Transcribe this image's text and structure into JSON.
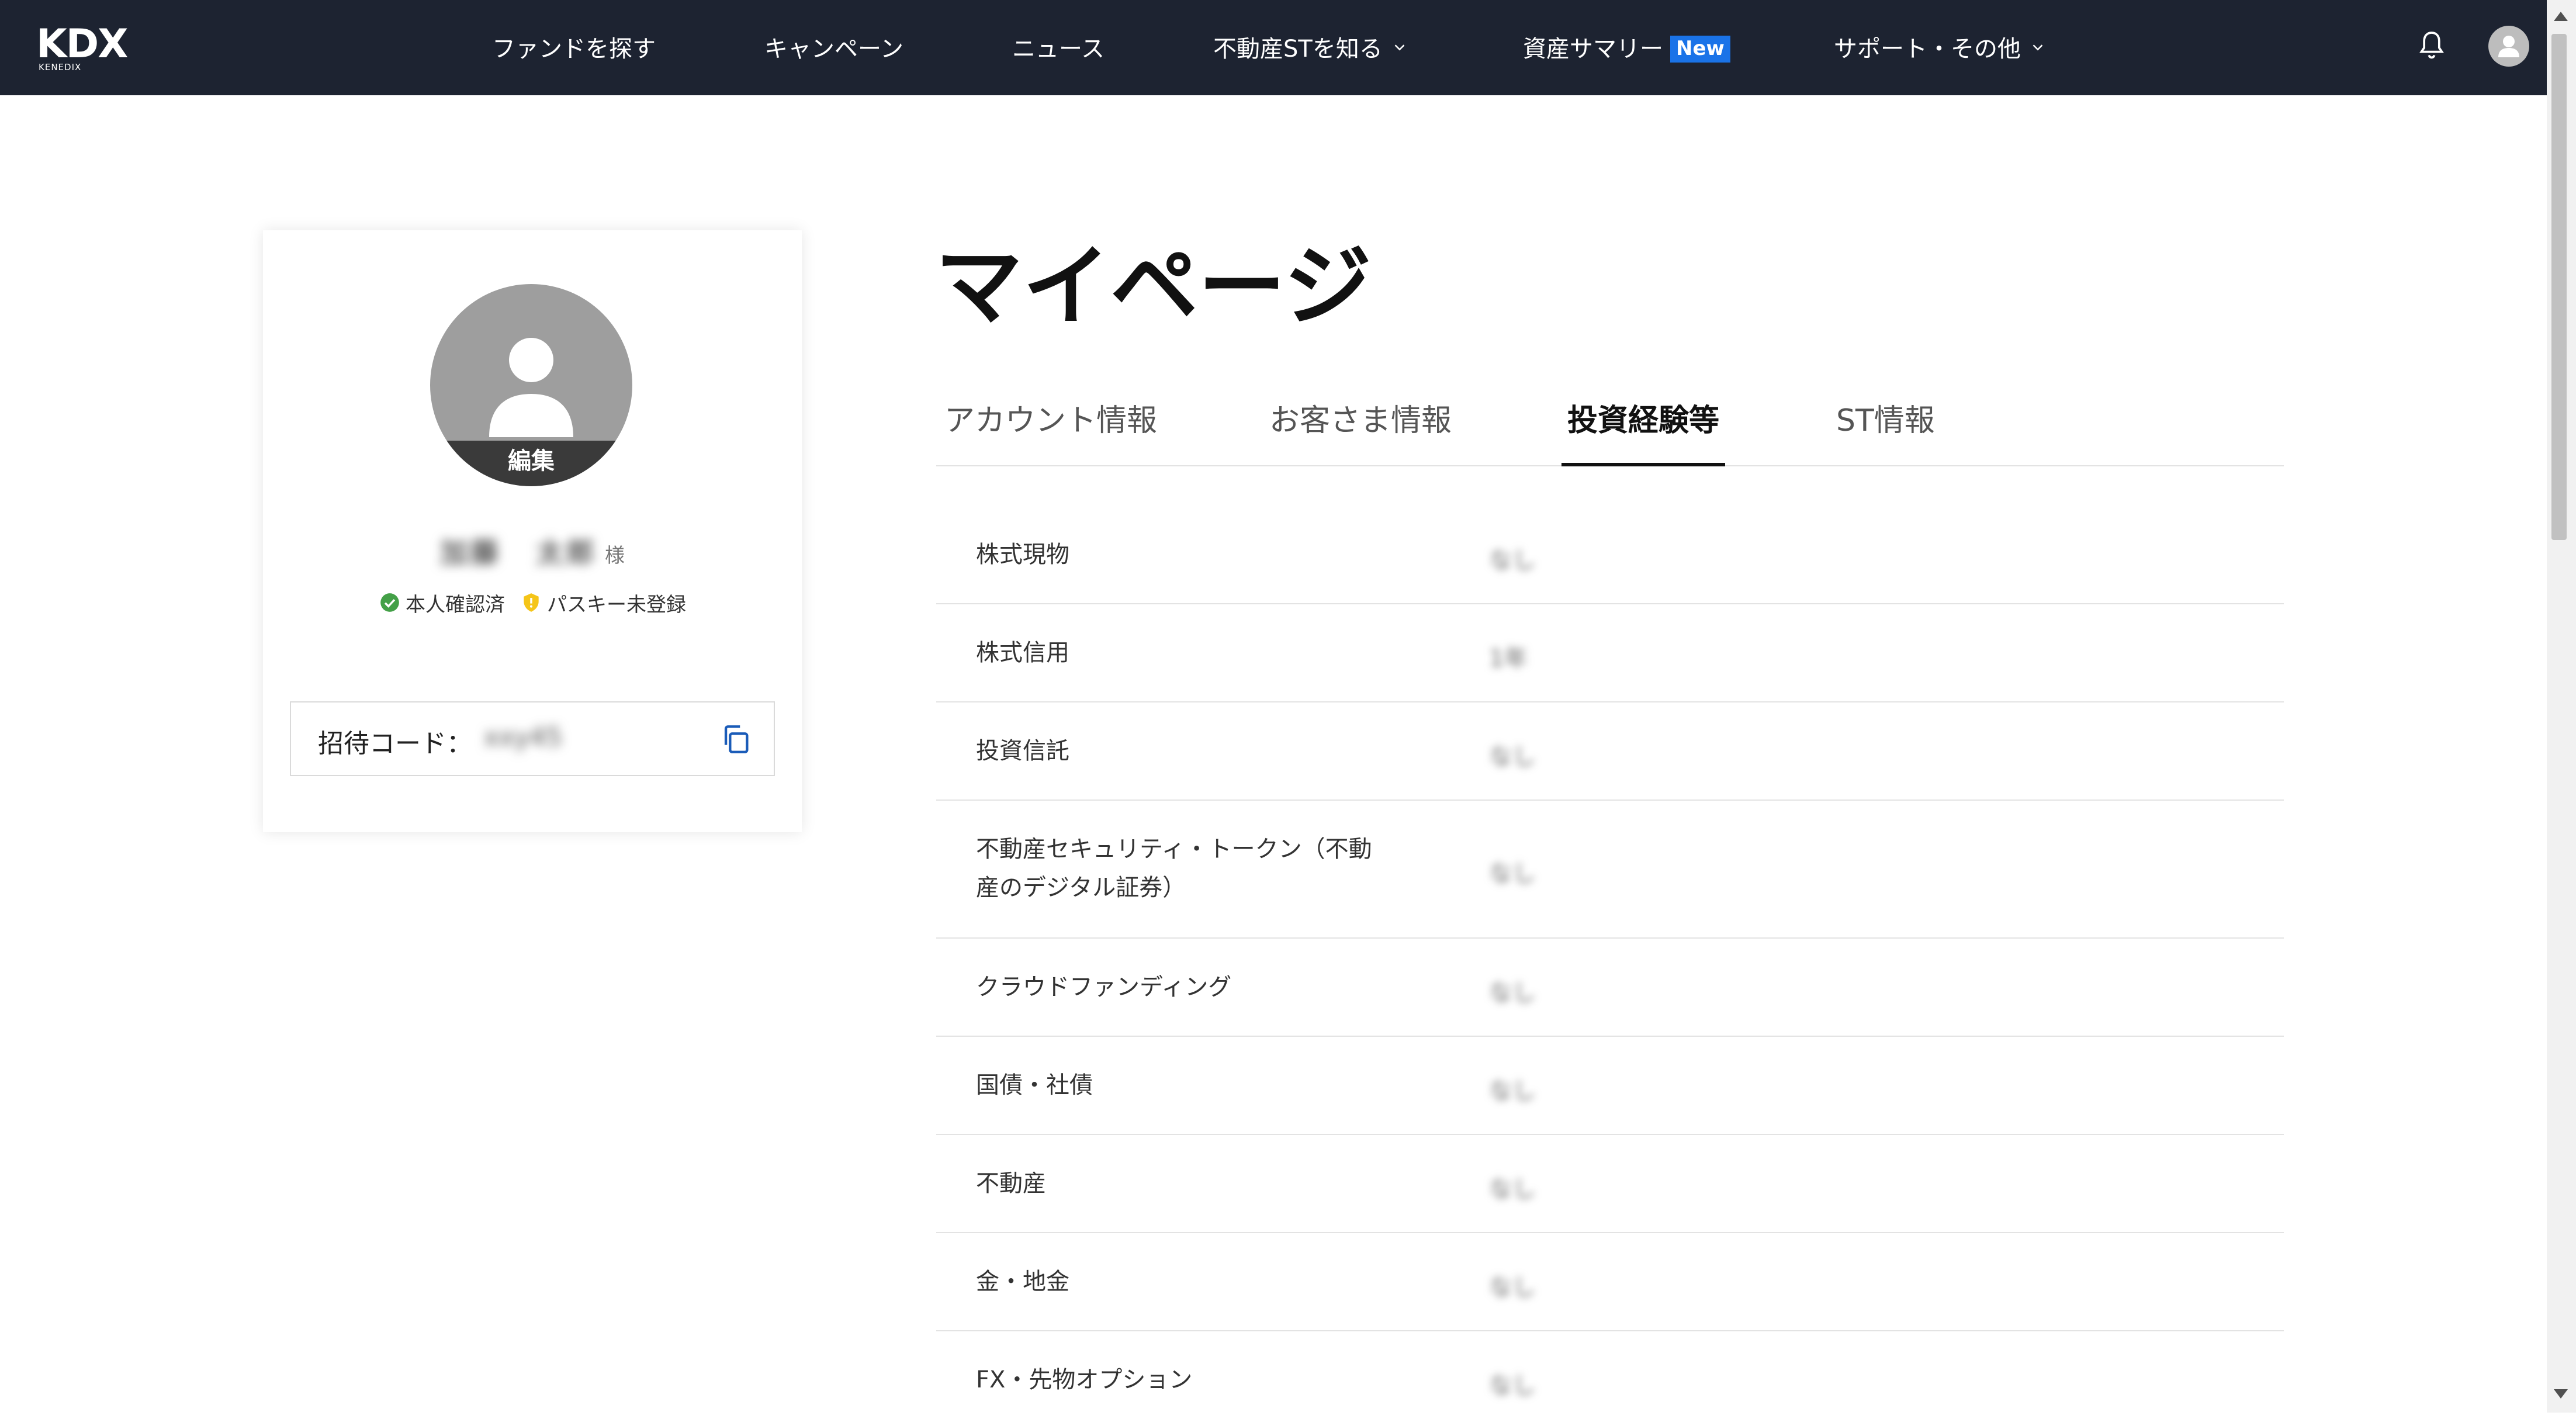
{
  "header": {
    "logo_text": "KDX",
    "logo_subtext": "KENEDIX",
    "nav": [
      {
        "label": "ファンドを探す"
      },
      {
        "label": "キャンペーン"
      },
      {
        "label": "ニュース"
      },
      {
        "label": "不動産STを知る"
      },
      {
        "label": "資産サマリー",
        "badge": "New"
      },
      {
        "label": "サポート・その他"
      }
    ],
    "icons": [
      "bell-icon",
      "user-avatar-icon"
    ]
  },
  "profile": {
    "avatar_edit_label": "編集",
    "name_last": "加藤",
    "name_first": "太郎",
    "honorific": "様",
    "verified_label": "本人確認済",
    "passkey_label": "パスキー未登録",
    "invite_label": "招待コード：",
    "invite_code": "xxy45",
    "colors": {
      "verified": "#43a047",
      "passkey": "#f5c518"
    }
  },
  "main": {
    "title": "マイページ",
    "tabs": [
      {
        "label": "アカウント情報",
        "active": false
      },
      {
        "label": "お客さま情報",
        "active": false
      },
      {
        "label": "投資経験等",
        "active": true
      },
      {
        "label": "ST情報",
        "active": false
      }
    ],
    "rows": [
      {
        "label": "株式現物",
        "value": "なし"
      },
      {
        "label": "株式信用",
        "value": "1年"
      },
      {
        "label": "投資信託",
        "value": "なし"
      },
      {
        "label": "不動産セキュリティ・トークン（不動産のデジタル証券）",
        "value": "なし"
      },
      {
        "label": "クラウドファンディング",
        "value": "なし"
      },
      {
        "label": "国債・社債",
        "value": "なし"
      },
      {
        "label": "不動産",
        "value": "なし"
      },
      {
        "label": "金・地金",
        "value": "なし"
      },
      {
        "label": "FX・先物オプション",
        "value": "なし"
      }
    ]
  },
  "theme": {
    "header_bg": "#1d2331",
    "badge_blue": "#1a73e8"
  }
}
